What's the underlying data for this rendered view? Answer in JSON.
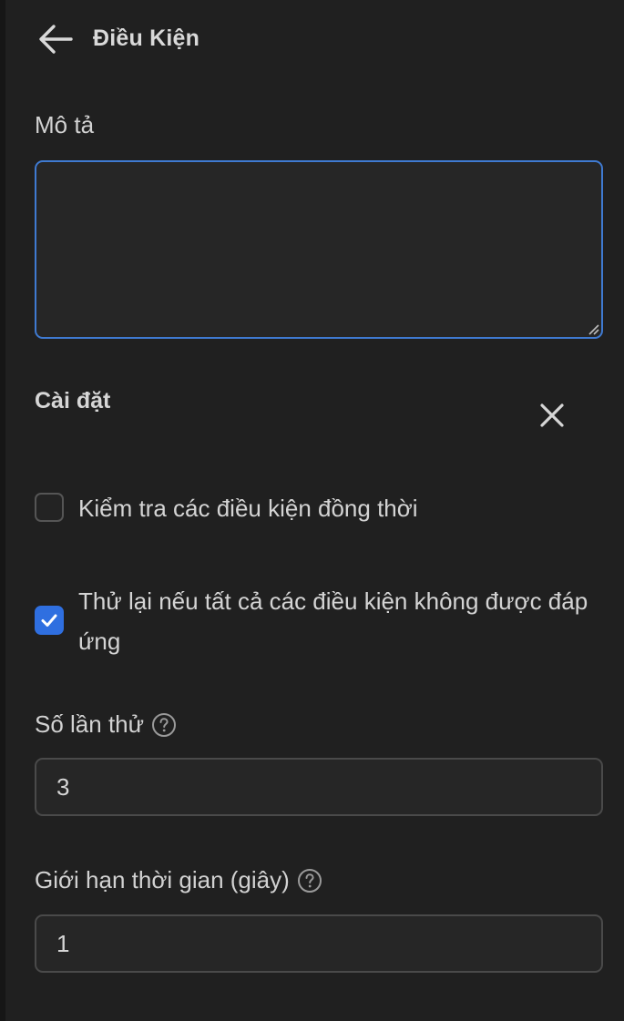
{
  "header": {
    "back_icon": "arrow-left-icon",
    "title": "Điều Kiện"
  },
  "description": {
    "label": "Mô tả",
    "value": "",
    "focused_border_color": "#3f7ad1"
  },
  "settings": {
    "title": "Cài đặt",
    "close_icon": "close-icon",
    "check_conditions_simultaneously": {
      "label": "Kiểm tra các điều kiện đồng thời",
      "checked": false
    },
    "retry_if_unmet": {
      "label": "Thử lại nếu tất cả các điều kiện không được đáp ứng",
      "checked": true,
      "accent_color": "#2f6fe0"
    }
  },
  "retry_count": {
    "label": "Số lần thử",
    "help_icon": "question-circle-icon",
    "value": "3"
  },
  "time_limit": {
    "label": "Giới hạn thời gian (giây)",
    "help_icon": "question-circle-icon",
    "value": "1"
  }
}
